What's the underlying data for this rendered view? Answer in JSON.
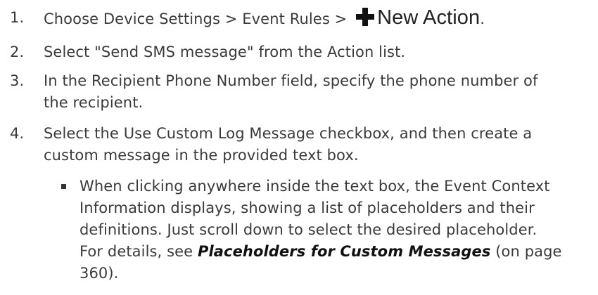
{
  "steps": [
    {
      "number": "1.",
      "text": "Choose Device Settings > Event Rules >",
      "action_label": "New Action",
      "trailing": "."
    },
    {
      "number": "2.",
      "text": "Select \"Send SMS message\" from the Action list."
    },
    {
      "number": "3.",
      "line1": "In the Recipient Phone Number field, specify the phone number of",
      "line2": "the recipient."
    },
    {
      "number": "4.",
      "line1": "Select the Use Custom Log Message checkbox, and then create a",
      "line2": "custom message in the provided text box."
    }
  ],
  "note": {
    "line1": "When clicking anywhere inside the text box, the Event Context",
    "line2": "Information displays, showing a list of placeholders and their",
    "line3": "definitions. Just scroll down to select the desired placeholder.",
    "line4_prefix": "For details, see",
    "link_text": "Placeholders for Custom Messages",
    "line4_suffix": "(on page",
    "line5": "360)."
  },
  "icons": {
    "new_action": "plus-icon"
  }
}
